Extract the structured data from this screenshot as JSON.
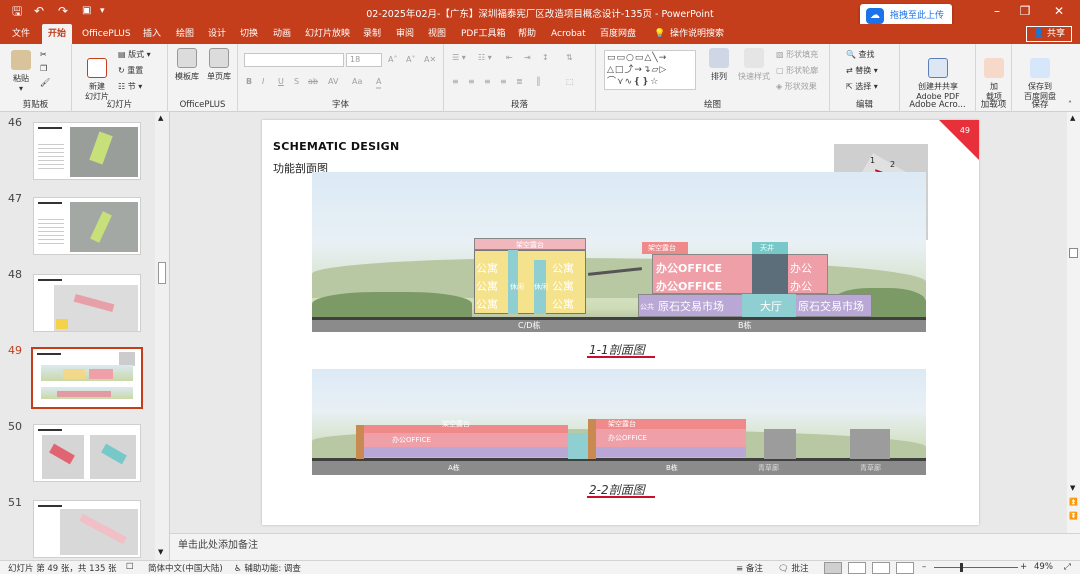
{
  "window": {
    "title": "02-2025年02月-【广东】深圳福泰宪厂区改造项目概念设计-135页  -  PowerPoint",
    "cloud_upload": "拖拽至此上传",
    "share": "共享"
  },
  "tabs": [
    "文件",
    "开始",
    "OfficePLUS",
    "插入",
    "绘图",
    "设计",
    "切换",
    "动画",
    "幻灯片放映",
    "录制",
    "审阅",
    "视图",
    "PDF工具箱",
    "帮助",
    "Acrobat",
    "百度网盘",
    "操作说明搜索"
  ],
  "active_tab": "开始",
  "ribbon": {
    "clipboard": {
      "label": "剪贴板",
      "paste": "粘贴"
    },
    "slides": {
      "label": "幻灯片",
      "new_slide": "新建\n幻灯片",
      "layout": "版式",
      "reset": "重置",
      "section": "节"
    },
    "officeplus": {
      "label": "OfficePLUS",
      "template": "模板库",
      "single_page": "单页库"
    },
    "font": {
      "label": "字体",
      "size": "18",
      "buttons": [
        "B",
        "I",
        "U",
        "S",
        "ab",
        "AV",
        "Aa",
        "A"
      ]
    },
    "paragraph": {
      "label": "段落"
    },
    "drawing": {
      "label": "绘图",
      "arrange": "排列",
      "quick_styles": "快速样式",
      "fill": "形状填充",
      "outline": "形状轮廓",
      "effects": "形状效果"
    },
    "editing": {
      "label": "编辑",
      "find": "查找",
      "replace": "替换",
      "select": "选择"
    },
    "adobe": {
      "label": "Adobe Acro...",
      "create": "创建并共享\nAdobe PDF"
    },
    "addins": {
      "label": "加载项",
      "add": "加\n载项"
    },
    "save": {
      "label": "保存",
      "save_to": "保存到\n百度网盘"
    }
  },
  "thumbnails": [
    {
      "num": "46",
      "selected": false
    },
    {
      "num": "47",
      "selected": false
    },
    {
      "num": "48",
      "selected": false
    },
    {
      "num": "49",
      "selected": true
    },
    {
      "num": "50",
      "selected": false
    },
    {
      "num": "51",
      "selected": false
    }
  ],
  "slide": {
    "title": "SCHEMATIC DESIGN",
    "subtitle": "功能剖面图",
    "page_number": "49",
    "keymap_labels": [
      "1",
      "2",
      "1",
      "2"
    ],
    "section1": {
      "caption": "1-1剖面图",
      "labels": [
        "架空露台",
        "公寓",
        "公寓",
        "公寓",
        "公寓",
        "公寓",
        "公寓",
        "架空露台",
        "天井",
        "办公OFFICE",
        "办公OFFICE",
        "办公",
        "办公",
        "原石交易市场",
        "大厅",
        "原石交易市场",
        "公共",
        "休闲",
        "休闲",
        "C/D栋",
        "B栋"
      ]
    },
    "section2": {
      "caption": "2-2剖面图",
      "labels": [
        "架空露台",
        "架空露台",
        "办公OFFICE",
        "办公OFFICE",
        "A栋",
        "B栋",
        "青草廊",
        "青草廊"
      ]
    }
  },
  "notes": "单击此处添加备注",
  "status": {
    "slide_count": "幻灯片 第 49 张，共 135 张",
    "language": "简体中文(中国大陆)",
    "accessibility": "辅助功能: 调查",
    "notes_btn": "备注",
    "comments_btn": "批注",
    "zoom": "49%"
  },
  "colors": {
    "accent": "#c43e1c",
    "apartment": "#f5e28c",
    "office": "#f2a3ab",
    "market": "#b9a7d6",
    "lobby": "#8fcfd1",
    "page_marker": "#e8303a"
  }
}
